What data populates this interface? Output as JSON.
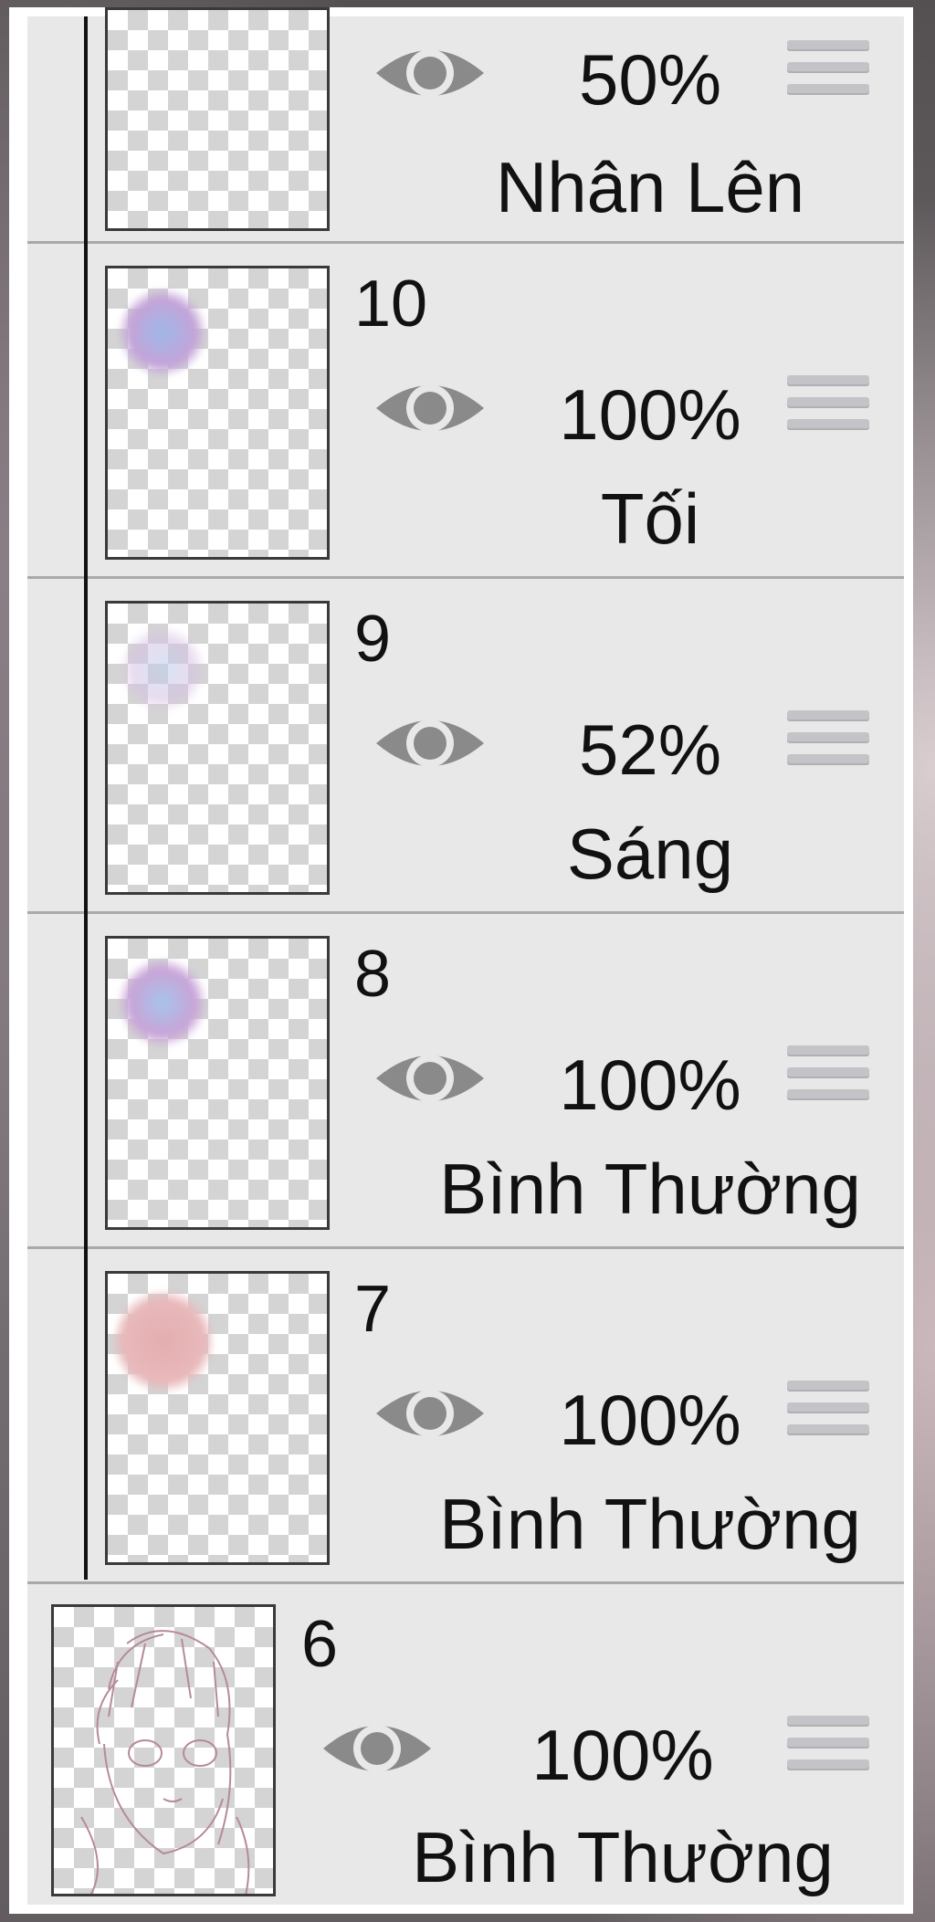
{
  "layers": [
    {
      "number": "",
      "opacity": "50%",
      "blend": "Nhân Lên"
    },
    {
      "number": "10",
      "opacity": "100%",
      "blend": "Tối"
    },
    {
      "number": "9",
      "opacity": "52%",
      "blend": "Sáng"
    },
    {
      "number": "8",
      "opacity": "100%",
      "blend": "Bình Thường"
    },
    {
      "number": "7",
      "opacity": "100%",
      "blend": "Bình Thường"
    },
    {
      "number": "6",
      "opacity": "100%",
      "blend": "Bình Thường"
    }
  ],
  "icons": {
    "visibility": "eye-icon",
    "reorder": "drag-handle-icon"
  },
  "colors": {
    "panel_bg": "#e8e8e8",
    "divider": "#a9a9a9",
    "eye_gray": "#8a8a8a",
    "handle": "#c4c4c8"
  }
}
